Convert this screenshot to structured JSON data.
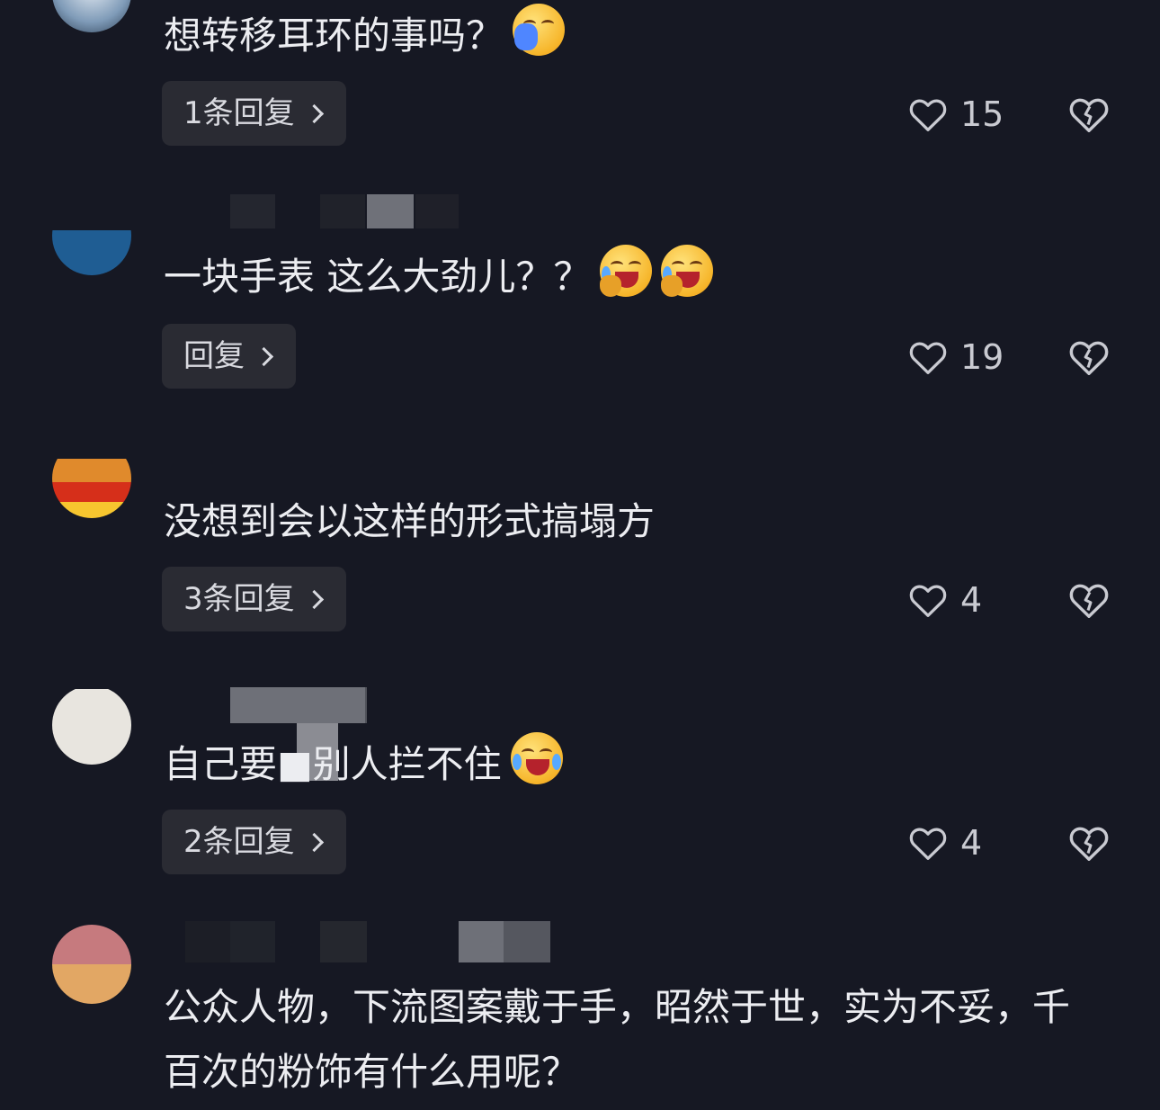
{
  "comments": [
    {
      "text": "想转移耳环的事吗？",
      "emoji": [
        "sick-face-emoji"
      ],
      "reply_label": "1条回复",
      "likes": "15"
    },
    {
      "text": "一块手表 这么大劲儿？？",
      "emoji": [
        "laughing-crying-emoji",
        "laughing-crying-emoji"
      ],
      "reply_label": "回复",
      "likes": "19"
    },
    {
      "text": "没想到会以这样的形式搞塌方",
      "emoji": [],
      "reply_label": "3条回复",
      "likes": "4"
    },
    {
      "text": "自己要■别人拦不住",
      "emoji": [
        "laughing-crying-emoji"
      ],
      "reply_label": "2条回复",
      "likes": "4"
    },
    {
      "text": "公众人物，下流图案戴于手，昭然于世，实为不妥，千百次的粉饰有什么用呢？",
      "emoji": [],
      "reply_label": "",
      "likes": ""
    }
  ],
  "colors": {
    "background": "#161823",
    "reply_button_bg": "#2a2b33",
    "text": "#ecedf1",
    "icon": "#c9cad1"
  },
  "icons": {
    "like": "heart-outline-icon",
    "dislike": "broken-heart-icon",
    "expand": "chevron-right-icon"
  }
}
